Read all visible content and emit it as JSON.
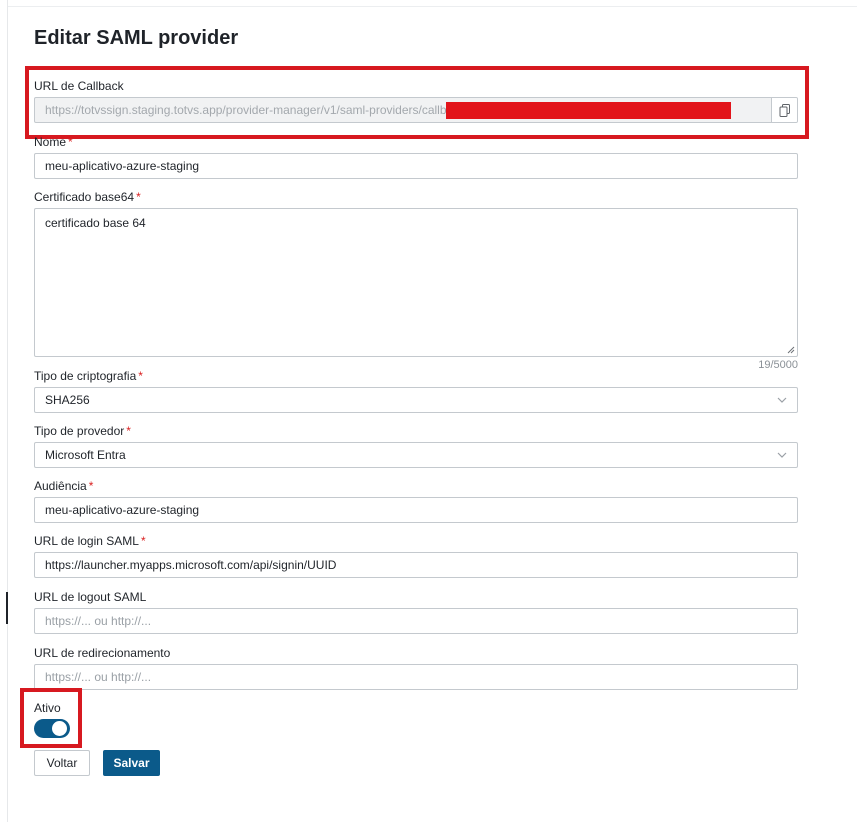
{
  "page": {
    "title": "Editar SAML provider"
  },
  "callback": {
    "label": "URL de Callback",
    "value": "https://totvssign.staging.totvs.app/provider-manager/v1/saml-providers/callback",
    "copy_icon": "copy-icon"
  },
  "name": {
    "label": "Nome",
    "required": "*",
    "value": "meu-aplicativo-azure-staging"
  },
  "certificate": {
    "label": "Certificado base64",
    "required": "*",
    "value": "certificado base 64",
    "counter": "19/5000"
  },
  "crypto": {
    "label": "Tipo de criptografia",
    "required": "*",
    "value": "SHA256"
  },
  "provider_type": {
    "label": "Tipo de provedor",
    "required": "*",
    "value": "Microsoft Entra"
  },
  "audience": {
    "label": "Audiência",
    "required": "*",
    "value": "meu-aplicativo-azure-staging"
  },
  "login_url": {
    "label": "URL de login SAML",
    "required": "*",
    "value": "https://launcher.myapps.microsoft.com/api/signin/UUID"
  },
  "logout_url": {
    "label": "URL de logout SAML",
    "placeholder": "https://... ou http://..."
  },
  "redirect_url": {
    "label": "URL de redirecionamento",
    "placeholder": "https://... ou http://..."
  },
  "active": {
    "label": "Ativo",
    "on": true
  },
  "buttons": {
    "back": "Voltar",
    "save": "Salvar"
  },
  "colors": {
    "primary": "#0b5a8a",
    "required": "#d92020",
    "highlight": "#d71920"
  }
}
